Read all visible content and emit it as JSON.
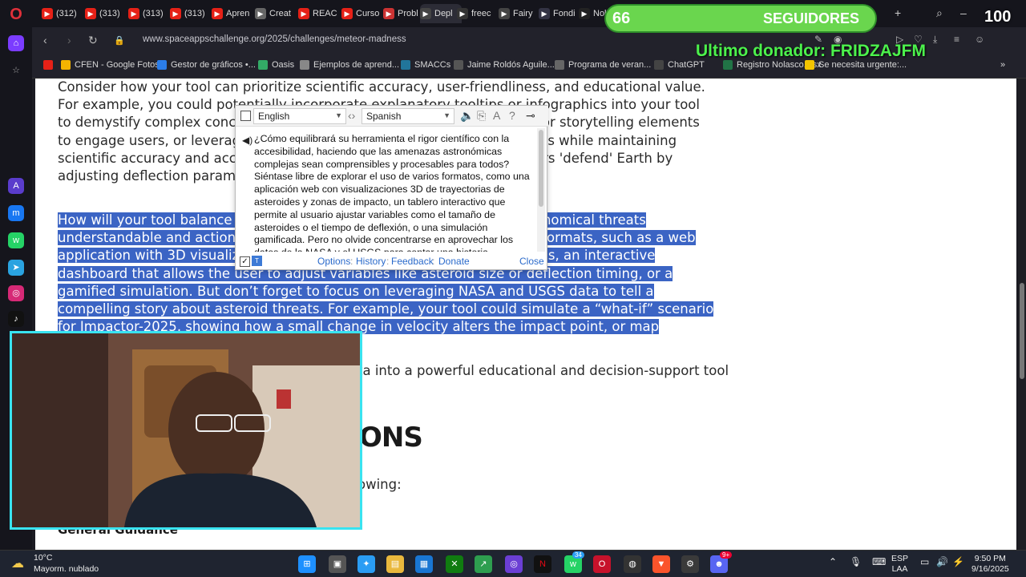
{
  "tabs": [
    {
      "label": "(312)",
      "icon": "youtube-icon",
      "color": "#e62117"
    },
    {
      "label": "(313)",
      "icon": "youtube-icon",
      "color": "#e62117"
    },
    {
      "label": "(313)",
      "icon": "youtube-icon",
      "color": "#e62117"
    },
    {
      "label": "(313)",
      "icon": "youtube-icon",
      "color": "#e62117"
    },
    {
      "label": "Apren",
      "icon": "youtube-icon",
      "color": "#e62117"
    },
    {
      "label": "Creat",
      "icon": "pen-icon",
      "color": "#666"
    },
    {
      "label": "REAC",
      "icon": "youtube-icon",
      "color": "#e62117"
    },
    {
      "label": "Curso",
      "icon": "youtube-icon",
      "color": "#e62117"
    },
    {
      "label": "Probl",
      "icon": "bookmark-icon",
      "color": "#c33"
    },
    {
      "label": "Depl",
      "icon": "notion-icon",
      "color": "#444"
    },
    {
      "label": "freec",
      "icon": "freecodecamp-icon",
      "color": "#333"
    },
    {
      "label": "Fairy",
      "icon": "font-icon",
      "color": "#444"
    },
    {
      "label": "Fondi",
      "icon": "wave-icon",
      "color": "#334"
    },
    {
      "label": "Nol",
      "icon": "github-icon",
      "color": "#222"
    }
  ],
  "url": "www.spaceappschallenge.org/2025/challenges/meteor-madness",
  "bookmarks": [
    {
      "label": "",
      "icon": "youtube-icon",
      "color": "#e62117"
    },
    {
      "label": "CFEN - Google Fotos",
      "icon": "photos-icon",
      "color": "#f4b400"
    },
    {
      "label": "Gestor de gráficos •...",
      "icon": "chart-icon",
      "color": "#2b7de9"
    },
    {
      "label": "Oasis",
      "icon": "globe-icon",
      "color": "#3a6"
    },
    {
      "label": "Ejemplos de aprend...",
      "icon": "page-icon",
      "color": "#888"
    },
    {
      "label": "SMACCs",
      "icon": "wordpress-icon",
      "color": "#21759b"
    },
    {
      "label": "Jaime Roldós Aguile...",
      "icon": "wikipedia-icon",
      "color": "#555"
    },
    {
      "label": "Programa de veran...",
      "icon": "gear-icon",
      "color": "#666"
    },
    {
      "label": "ChatGPT",
      "icon": "openai-icon",
      "color": "#444"
    },
    {
      "label": "Registro Nolasco.xlsx",
      "icon": "excel-icon",
      "color": "#217346"
    },
    {
      "label": "Se necesita urgente:...",
      "icon": "flag-icon",
      "color": "#f3c400"
    }
  ],
  "article": {
    "para1": "Consider how your tool can prioritize scientific accuracy, user-friendliness, and educational value. For example, you could potentially incorporate explanatory tooltips or infographics into your tool to demystify complex concepts. Be creative! Could you use gamification or storytelling elements to engage users, or leverage machine learning to predict impact outcomes while maintaining scientific accuracy and accessibility? For instance, your tool could let users 'defend' Earth by adjusting deflection parameters.",
    "para2": "How will your tool balance scientific rigor with accessibility, making astronomical threats understandable and actionable for all? Feel free to explore using various formats, such as a web application with 3D visualizations of asteroid trajectories and impact zones, an interactive dashboard that allows the user to adjust variables like asteroid size or deflection timing, or a gamified simulation. But don’t forget to focus on leveraging NASA and USGS data to tell a compelling story about asteroid threats. For example, your tool could simulate a “what-if” scenario for Impactor-2025, showing how a small change in velocity alters the impact point, or map tsunami risks using USGS elevation data.",
    "para3": "ta into a powerful educational and decision-support tool",
    "heading": "ONS",
    "para4": "owing:",
    "subhead": "General Guidance"
  },
  "translator": {
    "source_lang": "English",
    "target_lang": "Spanish",
    "text": "¿Cómo equilibrará su herramienta el rigor científico con la accesibilidad, haciendo que las amenazas astronómicas complejas sean comprensibles y procesables para todos? Siéntase libre de explorar el uso de varios formatos, como una aplicación web con visualizaciones 3D de trayectorias de asteroides y zonas de impacto, un tablero interactivo que permite al usuario ajustar variables como el tamaño de asteroides o el tiempo de deflexión, o una simulación gamificada. Pero no olvide concentrarse en aprovechar los datos de la NASA y el USGS para contar una historia convincente sobre las amenazas de",
    "options": "Options",
    "history": "History",
    "feedback": "Feedback",
    "donate": "Donate",
    "close": "Close"
  },
  "stream": {
    "followers_count": "66",
    "followers_label": "SEGUIDORES",
    "goal": "100",
    "last_donor": "Ultimo donador: FRIDZAJFM"
  },
  "taskbar": {
    "temp": "10°C",
    "weather": "Mayorm. nublado",
    "lang1": "ESP",
    "lang2": "LAA",
    "time": "9:50 PM",
    "date": "9/16/2025",
    "whatsapp_badge": "34",
    "discord_badge": "9+"
  }
}
